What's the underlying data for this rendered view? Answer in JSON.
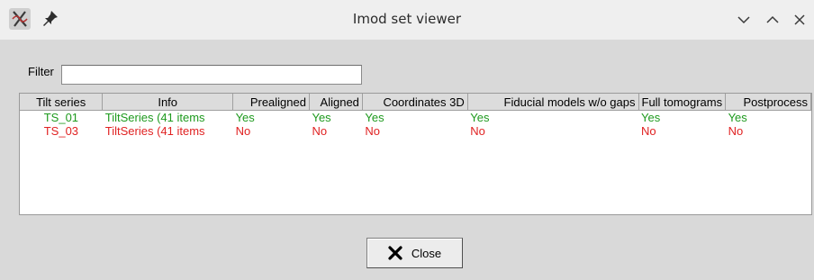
{
  "window": {
    "title": "Imod set viewer",
    "app_icon": "imod-x-icon",
    "pin_icon": "pin-icon",
    "controls": [
      "minimize-chevron-down-icon",
      "maximize-chevron-up-icon",
      "close-x-icon"
    ]
  },
  "filter": {
    "label": "Filter",
    "value": ""
  },
  "table": {
    "columns": [
      {
        "label": "Tilt series"
      },
      {
        "label": "Info"
      },
      {
        "label": "Prealigned"
      },
      {
        "label": "Aligned"
      },
      {
        "label": "Coordinates 3D"
      },
      {
        "label": "Fiducial models w/o gaps"
      },
      {
        "label": "Full tomograms"
      },
      {
        "label": "Postprocess"
      }
    ],
    "rows": [
      {
        "status": "ok",
        "color": "#1e9a1e",
        "cells": [
          "TS_01",
          "TiltSeries (41 items",
          "Yes",
          "Yes",
          "Yes",
          "Yes",
          "Yes",
          "Yes"
        ]
      },
      {
        "status": "bad",
        "color": "#e02222",
        "cells": [
          "TS_03",
          "TiltSeries (41 items",
          "No",
          "No",
          "No",
          "No",
          "No",
          "No"
        ]
      }
    ]
  },
  "close_button": {
    "label": "Close",
    "icon": "x-mark-icon"
  }
}
